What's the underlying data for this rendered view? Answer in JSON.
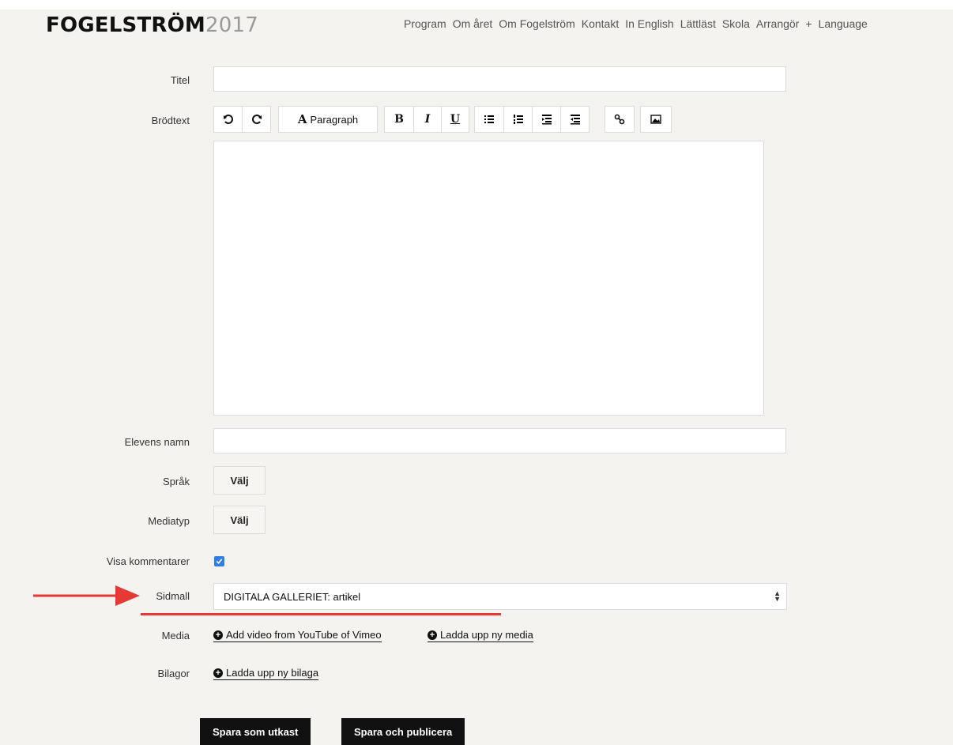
{
  "header": {
    "logo_main": "FOGELSTRÖM",
    "logo_year": "2017",
    "nav": [
      "Program",
      "Om året",
      "Om Fogelström",
      "Kontakt",
      "In English",
      "Lättläst",
      "Skola",
      "Arrangör",
      "+",
      "Language"
    ]
  },
  "form": {
    "titel_label": "Titel",
    "titel_value": "",
    "brodtext_label": "Brödtext",
    "toolbar": {
      "paragraph_label": "Paragraph",
      "bold": "B",
      "italic": "I",
      "underline": "U"
    },
    "elevens_namn_label": "Elevens namn",
    "elevens_namn_value": "",
    "sprak_label": "Språk",
    "sprak_button": "Välj",
    "mediatyp_label": "Mediatyp",
    "mediatyp_button": "Välj",
    "visa_kommentarer_label": "Visa kommentarer",
    "visa_kommentarer_checked": true,
    "sidmall_label": "Sidmall",
    "sidmall_value": "DIGITALA GALLERIET: artikel",
    "media_label": "Media",
    "media_links": [
      "Add video from YouTube of Vimeo",
      "Ladda upp ny media"
    ],
    "bilagor_label": "Bilagor",
    "bilagor_link": "Ladda upp ny bilaga"
  },
  "actions": {
    "draft": "Spara som utkast",
    "publish": "Spara och publicera"
  },
  "colors": {
    "background": "#f4f3ef",
    "checkbox": "#2f7ee6",
    "annotation_red": "#e53935",
    "button_bg": "#111111"
  }
}
